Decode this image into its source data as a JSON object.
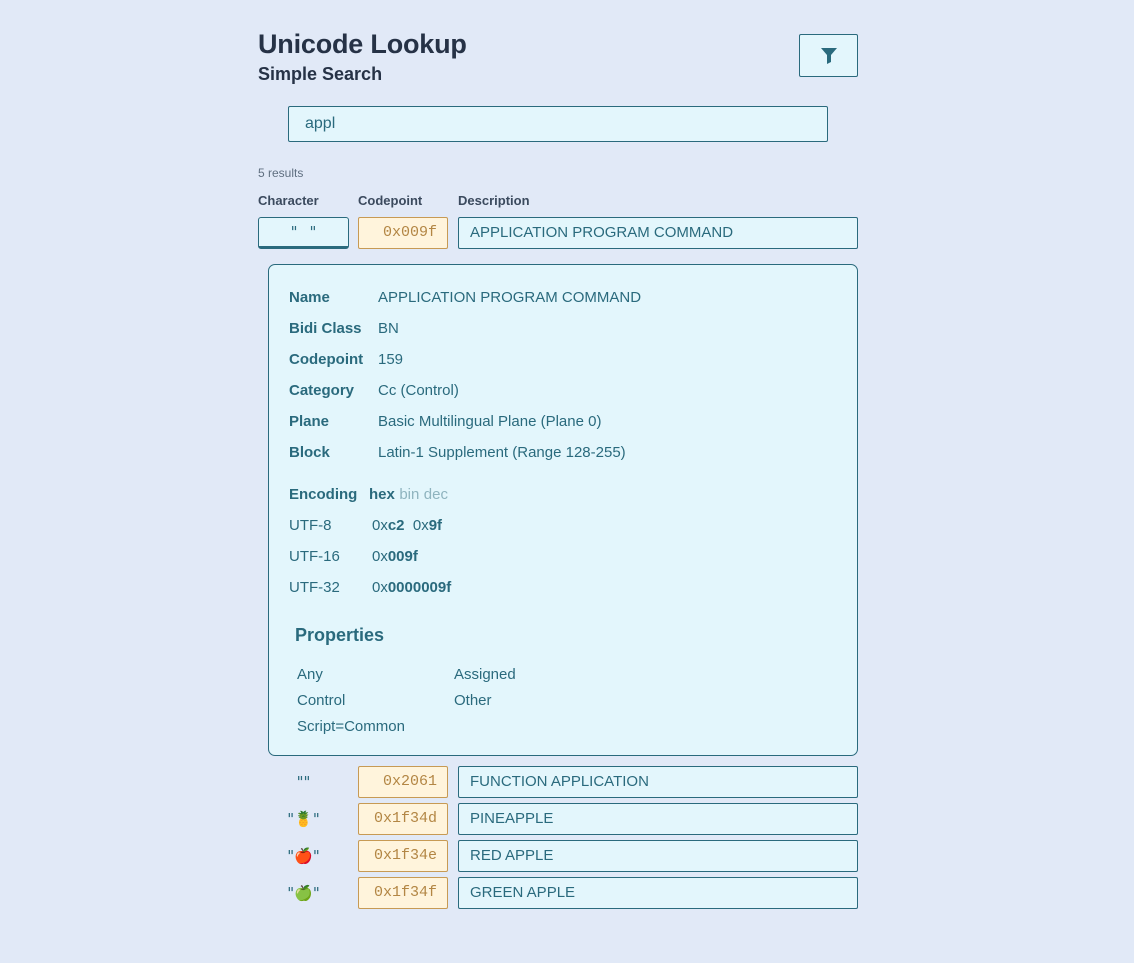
{
  "header": {
    "title": "Unicode Lookup",
    "subtitle": "Simple Search",
    "filter_icon": "filter-icon"
  },
  "search": {
    "value": "appl",
    "placeholder": ""
  },
  "results": {
    "count_label": "5 results",
    "columns": [
      "Character",
      "Codepoint",
      "Description"
    ],
    "rows": [
      {
        "char": "\"\"",
        "codepoint": "0x009f",
        "description": "APPLICATION PROGRAM COMMAND",
        "selected": true
      },
      {
        "char": "\"⁡\"",
        "codepoint": "0x2061",
        "description": "FUNCTION APPLICATION"
      },
      {
        "char": "\"🍍\"",
        "codepoint": "0x1f34d",
        "description": "PINEAPPLE"
      },
      {
        "char": "\"🍎\"",
        "codepoint": "0x1f34e",
        "description": "RED APPLE"
      },
      {
        "char": "\"🍏\"",
        "codepoint": "0x1f34f",
        "description": "GREEN APPLE"
      }
    ]
  },
  "detail": {
    "fields": [
      {
        "label": "Name",
        "value": "APPLICATION PROGRAM COMMAND"
      },
      {
        "label": "Bidi Class",
        "value": "BN"
      },
      {
        "label": "Codepoint",
        "value": "159"
      },
      {
        "label": "Category",
        "value": "Cc (Control)"
      },
      {
        "label": "Plane",
        "value": "Basic Multilingual Plane (Plane 0)"
      },
      {
        "label": "Block",
        "value": "Latin-1 Supplement (Range 128-255)"
      }
    ],
    "encoding": {
      "label": "Encoding",
      "modes": [
        "hex",
        "bin",
        "dec"
      ],
      "active_mode": "hex",
      "prefix": "0x",
      "rows": [
        {
          "label": "UTF-8",
          "bytes": [
            "c2",
            "9f"
          ]
        },
        {
          "label": "UTF-16",
          "bytes": [
            "009f"
          ]
        },
        {
          "label": "UTF-32",
          "bytes": [
            "0000009f"
          ]
        }
      ]
    },
    "properties": {
      "heading": "Properties",
      "items": [
        "Any",
        "Assigned",
        "Control",
        "Other",
        "Script=Common"
      ]
    }
  },
  "colors": {
    "background": "#e1e9f7",
    "accent": "#2a6a7d",
    "field_bg": "#e3f6fc",
    "codepoint_bg": "#fff4dc",
    "codepoint_border": "#c79a54",
    "title": "#263246"
  }
}
